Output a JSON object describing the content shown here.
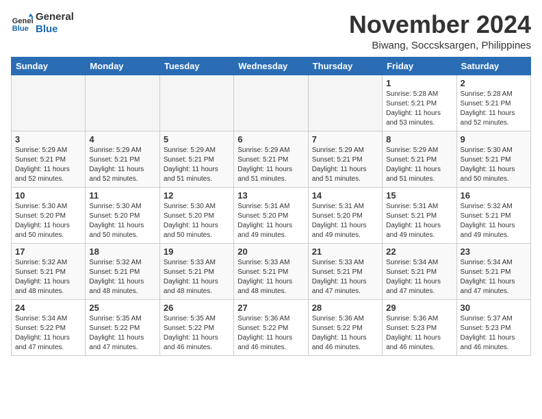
{
  "logo": {
    "text_general": "General",
    "text_blue": "Blue"
  },
  "header": {
    "month_year": "November 2024",
    "location": "Biwang, Soccsksargen, Philippines"
  },
  "weekdays": [
    "Sunday",
    "Monday",
    "Tuesday",
    "Wednesday",
    "Thursday",
    "Friday",
    "Saturday"
  ],
  "weeks": [
    [
      {
        "day": "",
        "empty": true
      },
      {
        "day": "",
        "empty": true
      },
      {
        "day": "",
        "empty": true
      },
      {
        "day": "",
        "empty": true
      },
      {
        "day": "",
        "empty": true
      },
      {
        "day": "1",
        "sunrise": "Sunrise: 5:28 AM",
        "sunset": "Sunset: 5:21 PM",
        "daylight": "Daylight: 11 hours and 53 minutes."
      },
      {
        "day": "2",
        "sunrise": "Sunrise: 5:28 AM",
        "sunset": "Sunset: 5:21 PM",
        "daylight": "Daylight: 11 hours and 52 minutes."
      }
    ],
    [
      {
        "day": "3",
        "sunrise": "Sunrise: 5:29 AM",
        "sunset": "Sunset: 5:21 PM",
        "daylight": "Daylight: 11 hours and 52 minutes."
      },
      {
        "day": "4",
        "sunrise": "Sunrise: 5:29 AM",
        "sunset": "Sunset: 5:21 PM",
        "daylight": "Daylight: 11 hours and 52 minutes."
      },
      {
        "day": "5",
        "sunrise": "Sunrise: 5:29 AM",
        "sunset": "Sunset: 5:21 PM",
        "daylight": "Daylight: 11 hours and 51 minutes."
      },
      {
        "day": "6",
        "sunrise": "Sunrise: 5:29 AM",
        "sunset": "Sunset: 5:21 PM",
        "daylight": "Daylight: 11 hours and 51 minutes."
      },
      {
        "day": "7",
        "sunrise": "Sunrise: 5:29 AM",
        "sunset": "Sunset: 5:21 PM",
        "daylight": "Daylight: 11 hours and 51 minutes."
      },
      {
        "day": "8",
        "sunrise": "Sunrise: 5:29 AM",
        "sunset": "Sunset: 5:21 PM",
        "daylight": "Daylight: 11 hours and 51 minutes."
      },
      {
        "day": "9",
        "sunrise": "Sunrise: 5:30 AM",
        "sunset": "Sunset: 5:21 PM",
        "daylight": "Daylight: 11 hours and 50 minutes."
      }
    ],
    [
      {
        "day": "10",
        "sunrise": "Sunrise: 5:30 AM",
        "sunset": "Sunset: 5:20 PM",
        "daylight": "Daylight: 11 hours and 50 minutes."
      },
      {
        "day": "11",
        "sunrise": "Sunrise: 5:30 AM",
        "sunset": "Sunset: 5:20 PM",
        "daylight": "Daylight: 11 hours and 50 minutes."
      },
      {
        "day": "12",
        "sunrise": "Sunrise: 5:30 AM",
        "sunset": "Sunset: 5:20 PM",
        "daylight": "Daylight: 11 hours and 50 minutes."
      },
      {
        "day": "13",
        "sunrise": "Sunrise: 5:31 AM",
        "sunset": "Sunset: 5:20 PM",
        "daylight": "Daylight: 11 hours and 49 minutes."
      },
      {
        "day": "14",
        "sunrise": "Sunrise: 5:31 AM",
        "sunset": "Sunset: 5:20 PM",
        "daylight": "Daylight: 11 hours and 49 minutes."
      },
      {
        "day": "15",
        "sunrise": "Sunrise: 5:31 AM",
        "sunset": "Sunset: 5:21 PM",
        "daylight": "Daylight: 11 hours and 49 minutes."
      },
      {
        "day": "16",
        "sunrise": "Sunrise: 5:32 AM",
        "sunset": "Sunset: 5:21 PM",
        "daylight": "Daylight: 11 hours and 49 minutes."
      }
    ],
    [
      {
        "day": "17",
        "sunrise": "Sunrise: 5:32 AM",
        "sunset": "Sunset: 5:21 PM",
        "daylight": "Daylight: 11 hours and 48 minutes."
      },
      {
        "day": "18",
        "sunrise": "Sunrise: 5:32 AM",
        "sunset": "Sunset: 5:21 PM",
        "daylight": "Daylight: 11 hours and 48 minutes."
      },
      {
        "day": "19",
        "sunrise": "Sunrise: 5:33 AM",
        "sunset": "Sunset: 5:21 PM",
        "daylight": "Daylight: 11 hours and 48 minutes."
      },
      {
        "day": "20",
        "sunrise": "Sunrise: 5:33 AM",
        "sunset": "Sunset: 5:21 PM",
        "daylight": "Daylight: 11 hours and 48 minutes."
      },
      {
        "day": "21",
        "sunrise": "Sunrise: 5:33 AM",
        "sunset": "Sunset: 5:21 PM",
        "daylight": "Daylight: 11 hours and 47 minutes."
      },
      {
        "day": "22",
        "sunrise": "Sunrise: 5:34 AM",
        "sunset": "Sunset: 5:21 PM",
        "daylight": "Daylight: 11 hours and 47 minutes."
      },
      {
        "day": "23",
        "sunrise": "Sunrise: 5:34 AM",
        "sunset": "Sunset: 5:21 PM",
        "daylight": "Daylight: 11 hours and 47 minutes."
      }
    ],
    [
      {
        "day": "24",
        "sunrise": "Sunrise: 5:34 AM",
        "sunset": "Sunset: 5:22 PM",
        "daylight": "Daylight: 11 hours and 47 minutes."
      },
      {
        "day": "25",
        "sunrise": "Sunrise: 5:35 AM",
        "sunset": "Sunset: 5:22 PM",
        "daylight": "Daylight: 11 hours and 47 minutes."
      },
      {
        "day": "26",
        "sunrise": "Sunrise: 5:35 AM",
        "sunset": "Sunset: 5:22 PM",
        "daylight": "Daylight: 11 hours and 46 minutes."
      },
      {
        "day": "27",
        "sunrise": "Sunrise: 5:36 AM",
        "sunset": "Sunset: 5:22 PM",
        "daylight": "Daylight: 11 hours and 46 minutes."
      },
      {
        "day": "28",
        "sunrise": "Sunrise: 5:36 AM",
        "sunset": "Sunset: 5:22 PM",
        "daylight": "Daylight: 11 hours and 46 minutes."
      },
      {
        "day": "29",
        "sunrise": "Sunrise: 5:36 AM",
        "sunset": "Sunset: 5:23 PM",
        "daylight": "Daylight: 11 hours and 46 minutes."
      },
      {
        "day": "30",
        "sunrise": "Sunrise: 5:37 AM",
        "sunset": "Sunset: 5:23 PM",
        "daylight": "Daylight: 11 hours and 46 minutes."
      }
    ]
  ]
}
